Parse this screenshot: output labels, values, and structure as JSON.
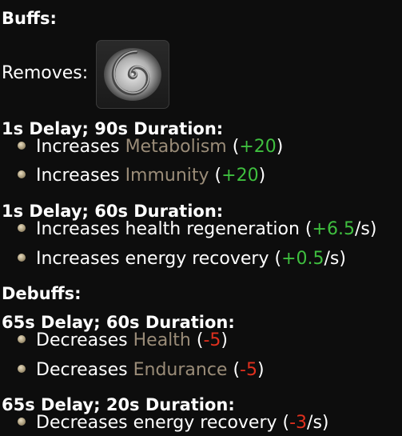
{
  "buffs_heading": "Buffs:",
  "removes_label": "Removes:",
  "removes_icon": "swirl-icon",
  "buff_groups": [
    {
      "header": "1s Delay; 90s Duration:",
      "items": [
        {
          "prefix": "Increases ",
          "stat": "Metabolism",
          "open": " (",
          "value": "+20",
          "unit": "",
          "close": ")"
        },
        {
          "prefix": "Increases ",
          "stat": "Immunity",
          "open": " (",
          "value": "+20",
          "unit": "",
          "close": ")"
        }
      ]
    },
    {
      "header": "1s Delay; 60s Duration:",
      "items": [
        {
          "prefix": "Increases health regeneration",
          "stat": "",
          "open": " (",
          "value": "+6.5",
          "unit": "/s",
          "close": ")"
        },
        {
          "prefix": "Increases energy recovery",
          "stat": "",
          "open": " (",
          "value": "+0.5",
          "unit": "/s",
          "close": ")"
        }
      ]
    }
  ],
  "debuffs_heading": "Debuffs:",
  "debuff_groups": [
    {
      "header": "65s Delay; 60s Duration:",
      "items": [
        {
          "prefix": "Decreases ",
          "stat": "Health",
          "open": " (",
          "value": "-5",
          "unit": "",
          "close": ")"
        },
        {
          "prefix": "Decreases ",
          "stat": "Endurance",
          "open": " (",
          "value": "-5",
          "unit": "",
          "close": ")"
        }
      ]
    },
    {
      "header": "65s Delay; 20s Duration:",
      "items": [
        {
          "prefix": "Decreases energy recovery",
          "stat": "",
          "open": " (",
          "value": "-3",
          "unit": "/s",
          "close": ")"
        }
      ]
    }
  ],
  "colors": {
    "background": "#0d0d0d",
    "stat_name": "#9a8c78",
    "positive": "#3fbf3f",
    "negative": "#e0301e"
  }
}
